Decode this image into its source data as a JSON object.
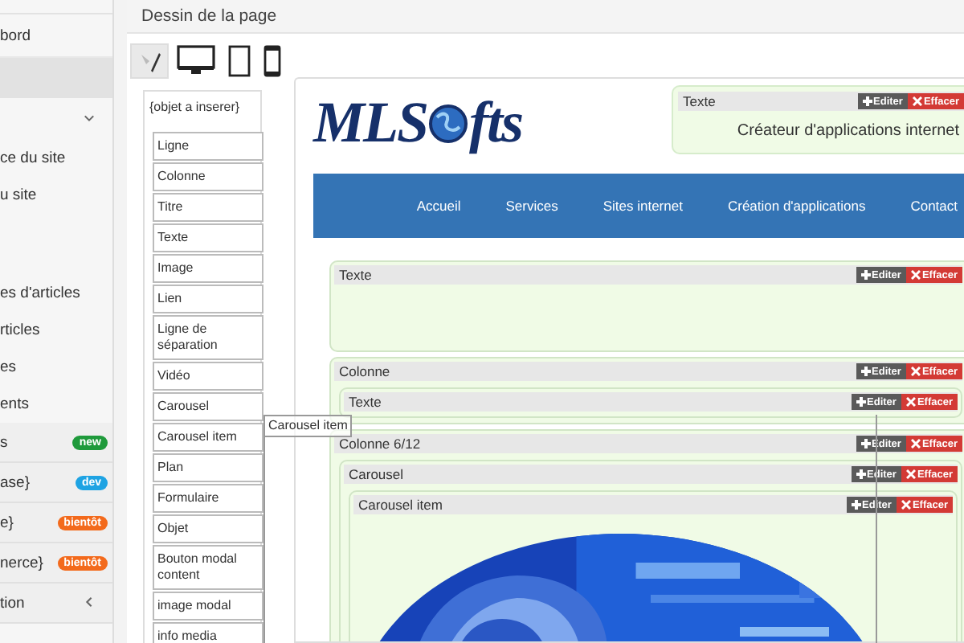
{
  "sidebar": {
    "sections": [
      [
        {
          "kind": "link",
          "label": "bord"
        }
      ],
      [
        {
          "kind": "group",
          "expanded": true
        },
        {
          "kind": "link",
          "label": "ce du site"
        },
        {
          "kind": "link",
          "label": "u site"
        }
      ],
      [
        {
          "kind": "link",
          "label": "es d'articles"
        },
        {
          "kind": "link",
          "label": "rticles"
        },
        {
          "kind": "link",
          "label": "es"
        },
        {
          "kind": "link",
          "label": "ents"
        }
      ],
      [
        {
          "kind": "badge",
          "label": "s",
          "badge": "new",
          "color": "#1f9a3b"
        },
        {
          "kind": "badge",
          "label": "ase}",
          "badge": "dev",
          "color": "#1ea3e3"
        },
        {
          "kind": "badge",
          "label": "e}",
          "badge": "bientôt",
          "color": "#f36a1c"
        },
        {
          "kind": "badge",
          "label": "nerce}",
          "badge": "bientôt",
          "color": "#f36a1c"
        },
        {
          "kind": "group",
          "label": "tion",
          "expanded": false
        }
      ]
    ]
  },
  "header": {
    "title": "Dessin de la page"
  },
  "devices": [
    {
      "kind": "edit",
      "selected": true
    },
    {
      "kind": "desktop",
      "selected": false
    },
    {
      "kind": "tablet",
      "selected": false
    },
    {
      "kind": "phone",
      "selected": false
    }
  ],
  "palette": {
    "title": "{objet a inserer}",
    "items": [
      "Ligne",
      "Colonne",
      "Titre",
      "Texte",
      "Image",
      "Lien",
      "Ligne de séparation",
      "Vidéo",
      "Carousel",
      "Carousel item",
      "Plan",
      "Formulaire",
      "Objet",
      "Bouton modal content",
      "image modal",
      "info media"
    ]
  },
  "drag_ghost": {
    "label": "Carousel item"
  },
  "canvas": {
    "logo": {
      "before": "MLS",
      "after": "fts"
    },
    "header_block": {
      "title": "Texte",
      "edit": "Editer",
      "delete": "Effacer",
      "text": "Créateur d'applications internet"
    },
    "nav": [
      "Accueil",
      "Services",
      "Sites internet",
      "Création d'applications",
      "Contact"
    ],
    "blocks": [
      {
        "kind": "text",
        "title": "Texte",
        "edit": "Editer",
        "delete": "Effacer"
      },
      {
        "kind": "container",
        "title": "Colonne",
        "edit": "Editer",
        "delete": "Effacer",
        "children": [
          {
            "kind": "container",
            "title": "Texte",
            "edit": "Editer",
            "delete": "Effacer"
          }
        ]
      },
      {
        "kind": "container",
        "title": "Colonne 6/12",
        "edit": "Editer",
        "delete": "Effacer",
        "children": [
          {
            "kind": "container",
            "title": "Carousel",
            "edit": "Editer",
            "delete": "Effacer",
            "children": [
              {
                "kind": "picture",
                "title": "Carousel item",
                "edit": "Editer",
                "delete": "Effacer"
              }
            ]
          }
        ]
      }
    ]
  }
}
